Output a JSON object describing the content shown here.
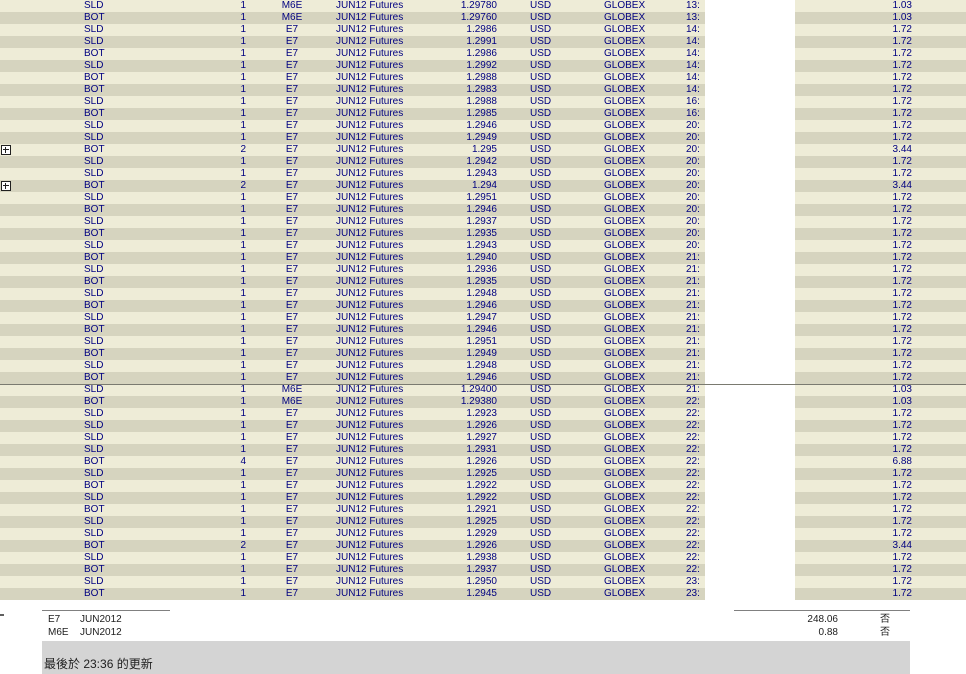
{
  "trades": [
    {
      "action": "SLD",
      "qty": "1",
      "symbol": "M6E",
      "desc": "JUN12 Futures",
      "price": "1.29780",
      "currency": "USD",
      "exchange": "GLOBEX",
      "time": "13:",
      "commission": "1.03"
    },
    {
      "action": "BOT",
      "qty": "1",
      "symbol": "M6E",
      "desc": "JUN12 Futures",
      "price": "1.29760",
      "currency": "USD",
      "exchange": "GLOBEX",
      "time": "13:",
      "commission": "1.03"
    },
    {
      "action": "SLD",
      "qty": "1",
      "symbol": "E7",
      "desc": "JUN12 Futures",
      "price": "1.2986",
      "currency": "USD",
      "exchange": "GLOBEX",
      "time": "14:",
      "commission": "1.72"
    },
    {
      "action": "SLD",
      "qty": "1",
      "symbol": "E7",
      "desc": "JUN12 Futures",
      "price": "1.2991",
      "currency": "USD",
      "exchange": "GLOBEX",
      "time": "14:",
      "commission": "1.72"
    },
    {
      "action": "BOT",
      "qty": "1",
      "symbol": "E7",
      "desc": "JUN12 Futures",
      "price": "1.2986",
      "currency": "USD",
      "exchange": "GLOBEX",
      "time": "14:",
      "commission": "1.72"
    },
    {
      "action": "SLD",
      "qty": "1",
      "symbol": "E7",
      "desc": "JUN12 Futures",
      "price": "1.2992",
      "currency": "USD",
      "exchange": "GLOBEX",
      "time": "14:",
      "commission": "1.72"
    },
    {
      "action": "BOT",
      "qty": "1",
      "symbol": "E7",
      "desc": "JUN12 Futures",
      "price": "1.2988",
      "currency": "USD",
      "exchange": "GLOBEX",
      "time": "14:",
      "commission": "1.72"
    },
    {
      "action": "BOT",
      "qty": "1",
      "symbol": "E7",
      "desc": "JUN12 Futures",
      "price": "1.2983",
      "currency": "USD",
      "exchange": "GLOBEX",
      "time": "14:",
      "commission": "1.72"
    },
    {
      "action": "SLD",
      "qty": "1",
      "symbol": "E7",
      "desc": "JUN12 Futures",
      "price": "1.2988",
      "currency": "USD",
      "exchange": "GLOBEX",
      "time": "16:",
      "commission": "1.72"
    },
    {
      "action": "BOT",
      "qty": "1",
      "symbol": "E7",
      "desc": "JUN12 Futures",
      "price": "1.2985",
      "currency": "USD",
      "exchange": "GLOBEX",
      "time": "16:",
      "commission": "1.72"
    },
    {
      "action": "SLD",
      "qty": "1",
      "symbol": "E7",
      "desc": "JUN12 Futures",
      "price": "1.2946",
      "currency": "USD",
      "exchange": "GLOBEX",
      "time": "20:",
      "commission": "1.72"
    },
    {
      "action": "SLD",
      "qty": "1",
      "symbol": "E7",
      "desc": "JUN12 Futures",
      "price": "1.2949",
      "currency": "USD",
      "exchange": "GLOBEX",
      "time": "20:",
      "commission": "1.72"
    },
    {
      "action": "BOT",
      "qty": "2",
      "symbol": "E7",
      "desc": "JUN12 Futures",
      "price": "1.295",
      "currency": "USD",
      "exchange": "GLOBEX",
      "time": "20:",
      "commission": "3.44",
      "expandable": true
    },
    {
      "action": "SLD",
      "qty": "1",
      "symbol": "E7",
      "desc": "JUN12 Futures",
      "price": "1.2942",
      "currency": "USD",
      "exchange": "GLOBEX",
      "time": "20:",
      "commission": "1.72"
    },
    {
      "action": "SLD",
      "qty": "1",
      "symbol": "E7",
      "desc": "JUN12 Futures",
      "price": "1.2943",
      "currency": "USD",
      "exchange": "GLOBEX",
      "time": "20:",
      "commission": "1.72"
    },
    {
      "action": "BOT",
      "qty": "2",
      "symbol": "E7",
      "desc": "JUN12 Futures",
      "price": "1.294",
      "currency": "USD",
      "exchange": "GLOBEX",
      "time": "20:",
      "commission": "3.44",
      "expandable": true
    },
    {
      "action": "SLD",
      "qty": "1",
      "symbol": "E7",
      "desc": "JUN12 Futures",
      "price": "1.2951",
      "currency": "USD",
      "exchange": "GLOBEX",
      "time": "20:",
      "commission": "1.72"
    },
    {
      "action": "BOT",
      "qty": "1",
      "symbol": "E7",
      "desc": "JUN12 Futures",
      "price": "1.2946",
      "currency": "USD",
      "exchange": "GLOBEX",
      "time": "20:",
      "commission": "1.72"
    },
    {
      "action": "SLD",
      "qty": "1",
      "symbol": "E7",
      "desc": "JUN12 Futures",
      "price": "1.2937",
      "currency": "USD",
      "exchange": "GLOBEX",
      "time": "20:",
      "commission": "1.72"
    },
    {
      "action": "BOT",
      "qty": "1",
      "symbol": "E7",
      "desc": "JUN12 Futures",
      "price": "1.2935",
      "currency": "USD",
      "exchange": "GLOBEX",
      "time": "20:",
      "commission": "1.72"
    },
    {
      "action": "SLD",
      "qty": "1",
      "symbol": "E7",
      "desc": "JUN12 Futures",
      "price": "1.2943",
      "currency": "USD",
      "exchange": "GLOBEX",
      "time": "20:",
      "commission": "1.72"
    },
    {
      "action": "BOT",
      "qty": "1",
      "symbol": "E7",
      "desc": "JUN12 Futures",
      "price": "1.2940",
      "currency": "USD",
      "exchange": "GLOBEX",
      "time": "21:",
      "commission": "1.72"
    },
    {
      "action": "SLD",
      "qty": "1",
      "symbol": "E7",
      "desc": "JUN12 Futures",
      "price": "1.2936",
      "currency": "USD",
      "exchange": "GLOBEX",
      "time": "21:",
      "commission": "1.72"
    },
    {
      "action": "BOT",
      "qty": "1",
      "symbol": "E7",
      "desc": "JUN12 Futures",
      "price": "1.2935",
      "currency": "USD",
      "exchange": "GLOBEX",
      "time": "21:",
      "commission": "1.72"
    },
    {
      "action": "SLD",
      "qty": "1",
      "symbol": "E7",
      "desc": "JUN12 Futures",
      "price": "1.2948",
      "currency": "USD",
      "exchange": "GLOBEX",
      "time": "21:",
      "commission": "1.72"
    },
    {
      "action": "BOT",
      "qty": "1",
      "symbol": "E7",
      "desc": "JUN12 Futures",
      "price": "1.2946",
      "currency": "USD",
      "exchange": "GLOBEX",
      "time": "21:",
      "commission": "1.72"
    },
    {
      "action": "SLD",
      "qty": "1",
      "symbol": "E7",
      "desc": "JUN12 Futures",
      "price": "1.2947",
      "currency": "USD",
      "exchange": "GLOBEX",
      "time": "21:",
      "commission": "1.72"
    },
    {
      "action": "BOT",
      "qty": "1",
      "symbol": "E7",
      "desc": "JUN12 Futures",
      "price": "1.2946",
      "currency": "USD",
      "exchange": "GLOBEX",
      "time": "21:",
      "commission": "1.72"
    },
    {
      "action": "SLD",
      "qty": "1",
      "symbol": "E7",
      "desc": "JUN12 Futures",
      "price": "1.2951",
      "currency": "USD",
      "exchange": "GLOBEX",
      "time": "21:",
      "commission": "1.72"
    },
    {
      "action": "BOT",
      "qty": "1",
      "symbol": "E7",
      "desc": "JUN12 Futures",
      "price": "1.2949",
      "currency": "USD",
      "exchange": "GLOBEX",
      "time": "21:",
      "commission": "1.72"
    },
    {
      "action": "SLD",
      "qty": "1",
      "symbol": "E7",
      "desc": "JUN12 Futures",
      "price": "1.2948",
      "currency": "USD",
      "exchange": "GLOBEX",
      "time": "21:",
      "commission": "1.72"
    },
    {
      "action": "BOT",
      "qty": "1",
      "symbol": "E7",
      "desc": "JUN12 Futures",
      "price": "1.2946",
      "currency": "USD",
      "exchange": "GLOBEX",
      "time": "21:",
      "commission": "1.72"
    },
    {
      "action": "SLD",
      "qty": "1",
      "symbol": "M6E",
      "desc": "JUN12 Futures",
      "price": "1.29400",
      "currency": "USD",
      "exchange": "GLOBEX",
      "time": "21:",
      "commission": "1.03"
    },
    {
      "action": "BOT",
      "qty": "1",
      "symbol": "M6E",
      "desc": "JUN12 Futures",
      "price": "1.29380",
      "currency": "USD",
      "exchange": "GLOBEX",
      "time": "22:",
      "commission": "1.03"
    },
    {
      "action": "SLD",
      "qty": "1",
      "symbol": "E7",
      "desc": "JUN12 Futures",
      "price": "1.2923",
      "currency": "USD",
      "exchange": "GLOBEX",
      "time": "22:",
      "commission": "1.72"
    },
    {
      "action": "SLD",
      "qty": "1",
      "symbol": "E7",
      "desc": "JUN12 Futures",
      "price": "1.2926",
      "currency": "USD",
      "exchange": "GLOBEX",
      "time": "22:",
      "commission": "1.72"
    },
    {
      "action": "SLD",
      "qty": "1",
      "symbol": "E7",
      "desc": "JUN12 Futures",
      "price": "1.2927",
      "currency": "USD",
      "exchange": "GLOBEX",
      "time": "22:",
      "commission": "1.72"
    },
    {
      "action": "SLD",
      "qty": "1",
      "symbol": "E7",
      "desc": "JUN12 Futures",
      "price": "1.2931",
      "currency": "USD",
      "exchange": "GLOBEX",
      "time": "22:",
      "commission": "1.72"
    },
    {
      "action": "BOT",
      "qty": "4",
      "symbol": "E7",
      "desc": "JUN12 Futures",
      "price": "1.2926",
      "currency": "USD",
      "exchange": "GLOBEX",
      "time": "22:",
      "commission": "6.88"
    },
    {
      "action": "SLD",
      "qty": "1",
      "symbol": "E7",
      "desc": "JUN12 Futures",
      "price": "1.2925",
      "currency": "USD",
      "exchange": "GLOBEX",
      "time": "22:",
      "commission": "1.72"
    },
    {
      "action": "BOT",
      "qty": "1",
      "symbol": "E7",
      "desc": "JUN12 Futures",
      "price": "1.2922",
      "currency": "USD",
      "exchange": "GLOBEX",
      "time": "22:",
      "commission": "1.72"
    },
    {
      "action": "SLD",
      "qty": "1",
      "symbol": "E7",
      "desc": "JUN12 Futures",
      "price": "1.2922",
      "currency": "USD",
      "exchange": "GLOBEX",
      "time": "22:",
      "commission": "1.72"
    },
    {
      "action": "BOT",
      "qty": "1",
      "symbol": "E7",
      "desc": "JUN12 Futures",
      "price": "1.2921",
      "currency": "USD",
      "exchange": "GLOBEX",
      "time": "22:",
      "commission": "1.72"
    },
    {
      "action": "SLD",
      "qty": "1",
      "symbol": "E7",
      "desc": "JUN12 Futures",
      "price": "1.2925",
      "currency": "USD",
      "exchange": "GLOBEX",
      "time": "22:",
      "commission": "1.72"
    },
    {
      "action": "SLD",
      "qty": "1",
      "symbol": "E7",
      "desc": "JUN12 Futures",
      "price": "1.2929",
      "currency": "USD",
      "exchange": "GLOBEX",
      "time": "22:",
      "commission": "1.72"
    },
    {
      "action": "BOT",
      "qty": "2",
      "symbol": "E7",
      "desc": "JUN12 Futures",
      "price": "1.2926",
      "currency": "USD",
      "exchange": "GLOBEX",
      "time": "22:",
      "commission": "3.44"
    },
    {
      "action": "SLD",
      "qty": "1",
      "symbol": "E7",
      "desc": "JUN12 Futures",
      "price": "1.2938",
      "currency": "USD",
      "exchange": "GLOBEX",
      "time": "22:",
      "commission": "1.72"
    },
    {
      "action": "BOT",
      "qty": "1",
      "symbol": "E7",
      "desc": "JUN12 Futures",
      "price": "1.2937",
      "currency": "USD",
      "exchange": "GLOBEX",
      "time": "22:",
      "commission": "1.72"
    },
    {
      "action": "SLD",
      "qty": "1",
      "symbol": "E7",
      "desc": "JUN12 Futures",
      "price": "1.2950",
      "currency": "USD",
      "exchange": "GLOBEX",
      "time": "23:",
      "commission": "1.72"
    },
    {
      "action": "BOT",
      "qty": "1",
      "symbol": "E7",
      "desc": "JUN12 Futures",
      "price": "1.2945",
      "currency": "USD",
      "exchange": "GLOBEX",
      "time": "23:",
      "commission": "1.72"
    }
  ],
  "summary": [
    {
      "symbol": "E7",
      "month": "JUN2012",
      "value": "248.06",
      "flag": "否"
    },
    {
      "symbol": "M6E",
      "month": "JUN2012",
      "value": "0.88",
      "flag": "否"
    }
  ],
  "status": {
    "text": "最後於 23:36 的更新"
  },
  "colors": {
    "row_light": "#eeecd7",
    "row_dark": "#d6d4bf",
    "text": "#000080",
    "status_bar": "#d4d4d4"
  }
}
